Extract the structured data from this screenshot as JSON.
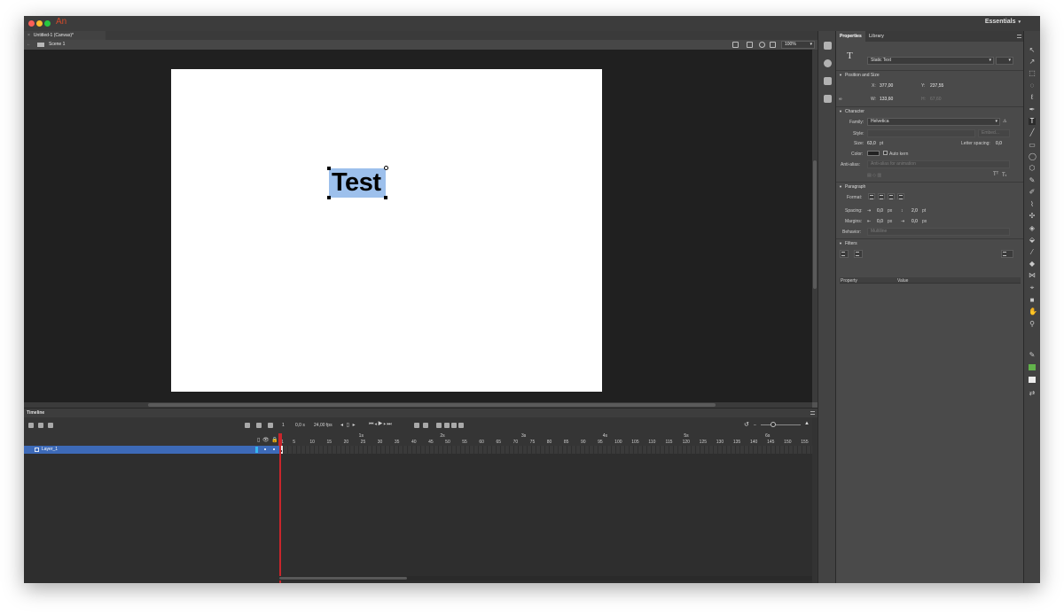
{
  "app": {
    "logo_text": "An",
    "workspace": "Essentials"
  },
  "document": {
    "tab_title": "Untitled-1 (Canvas)*",
    "scene": "Scene 1",
    "zoom": "100%",
    "stage_text": "Test"
  },
  "timeline": {
    "title": "Timeline",
    "current_frame": "1",
    "time": "0,0 s",
    "fps": "24,00 fps",
    "seconds_labels": [
      "1s",
      "2s",
      "3s",
      "4s",
      "5s",
      "6s"
    ],
    "frame_labels": [
      "1",
      "5",
      "10",
      "15",
      "20",
      "25",
      "30",
      "35",
      "40",
      "45",
      "50",
      "55",
      "60",
      "65",
      "70",
      "75",
      "80",
      "85",
      "90",
      "95",
      "100",
      "105",
      "110",
      "115",
      "120",
      "125",
      "130",
      "135",
      "140",
      "145",
      "150",
      "155"
    ],
    "layers": [
      {
        "name": "Layer_1",
        "selected": true
      }
    ]
  },
  "properties": {
    "tabs": [
      "Properties",
      "Library"
    ],
    "text_type": "Static Text",
    "position_size": {
      "title": "Position and Size",
      "x_label": "X:",
      "x": "377,00",
      "y_label": "Y:",
      "y": "237,55",
      "w_label": "W:",
      "w": "133,60",
      "h_label": "H:",
      "h": "67,60"
    },
    "character": {
      "title": "Character",
      "family_label": "Family:",
      "family": "Helvetica",
      "style_label": "Style:",
      "style": "",
      "embed_label": "Embed...",
      "size_label": "Size:",
      "size": "63,0",
      "size_unit": "pt",
      "letter_spacing_label": "Letter spacing:",
      "letter_spacing": "0,0",
      "color_label": "Color:",
      "auto_kern_label": "Auto kern",
      "anti_alias_label": "Anti-alias:",
      "anti_alias": "Anti-alias for animation"
    },
    "paragraph": {
      "title": "Paragraph",
      "format_label": "Format:",
      "spacing_label": "Spacing:",
      "spacing_indent": "0,0",
      "spacing_indent_unit": "px",
      "spacing_line": "2,0",
      "spacing_line_unit": "pt",
      "margins_label": "Margins:",
      "margin_left": "0,0",
      "margin_left_unit": "px",
      "margin_right": "0,0",
      "margin_right_unit": "px",
      "behavior_label": "Behavior:",
      "behavior": "Multiline"
    },
    "filters": {
      "title": "Filters",
      "col_property": "Property",
      "col_value": "Value"
    }
  },
  "colors": {
    "stroke": "#62b34b",
    "fill": "#ececec",
    "selection": "#3d6ab8",
    "playhead": "#c9252b"
  }
}
